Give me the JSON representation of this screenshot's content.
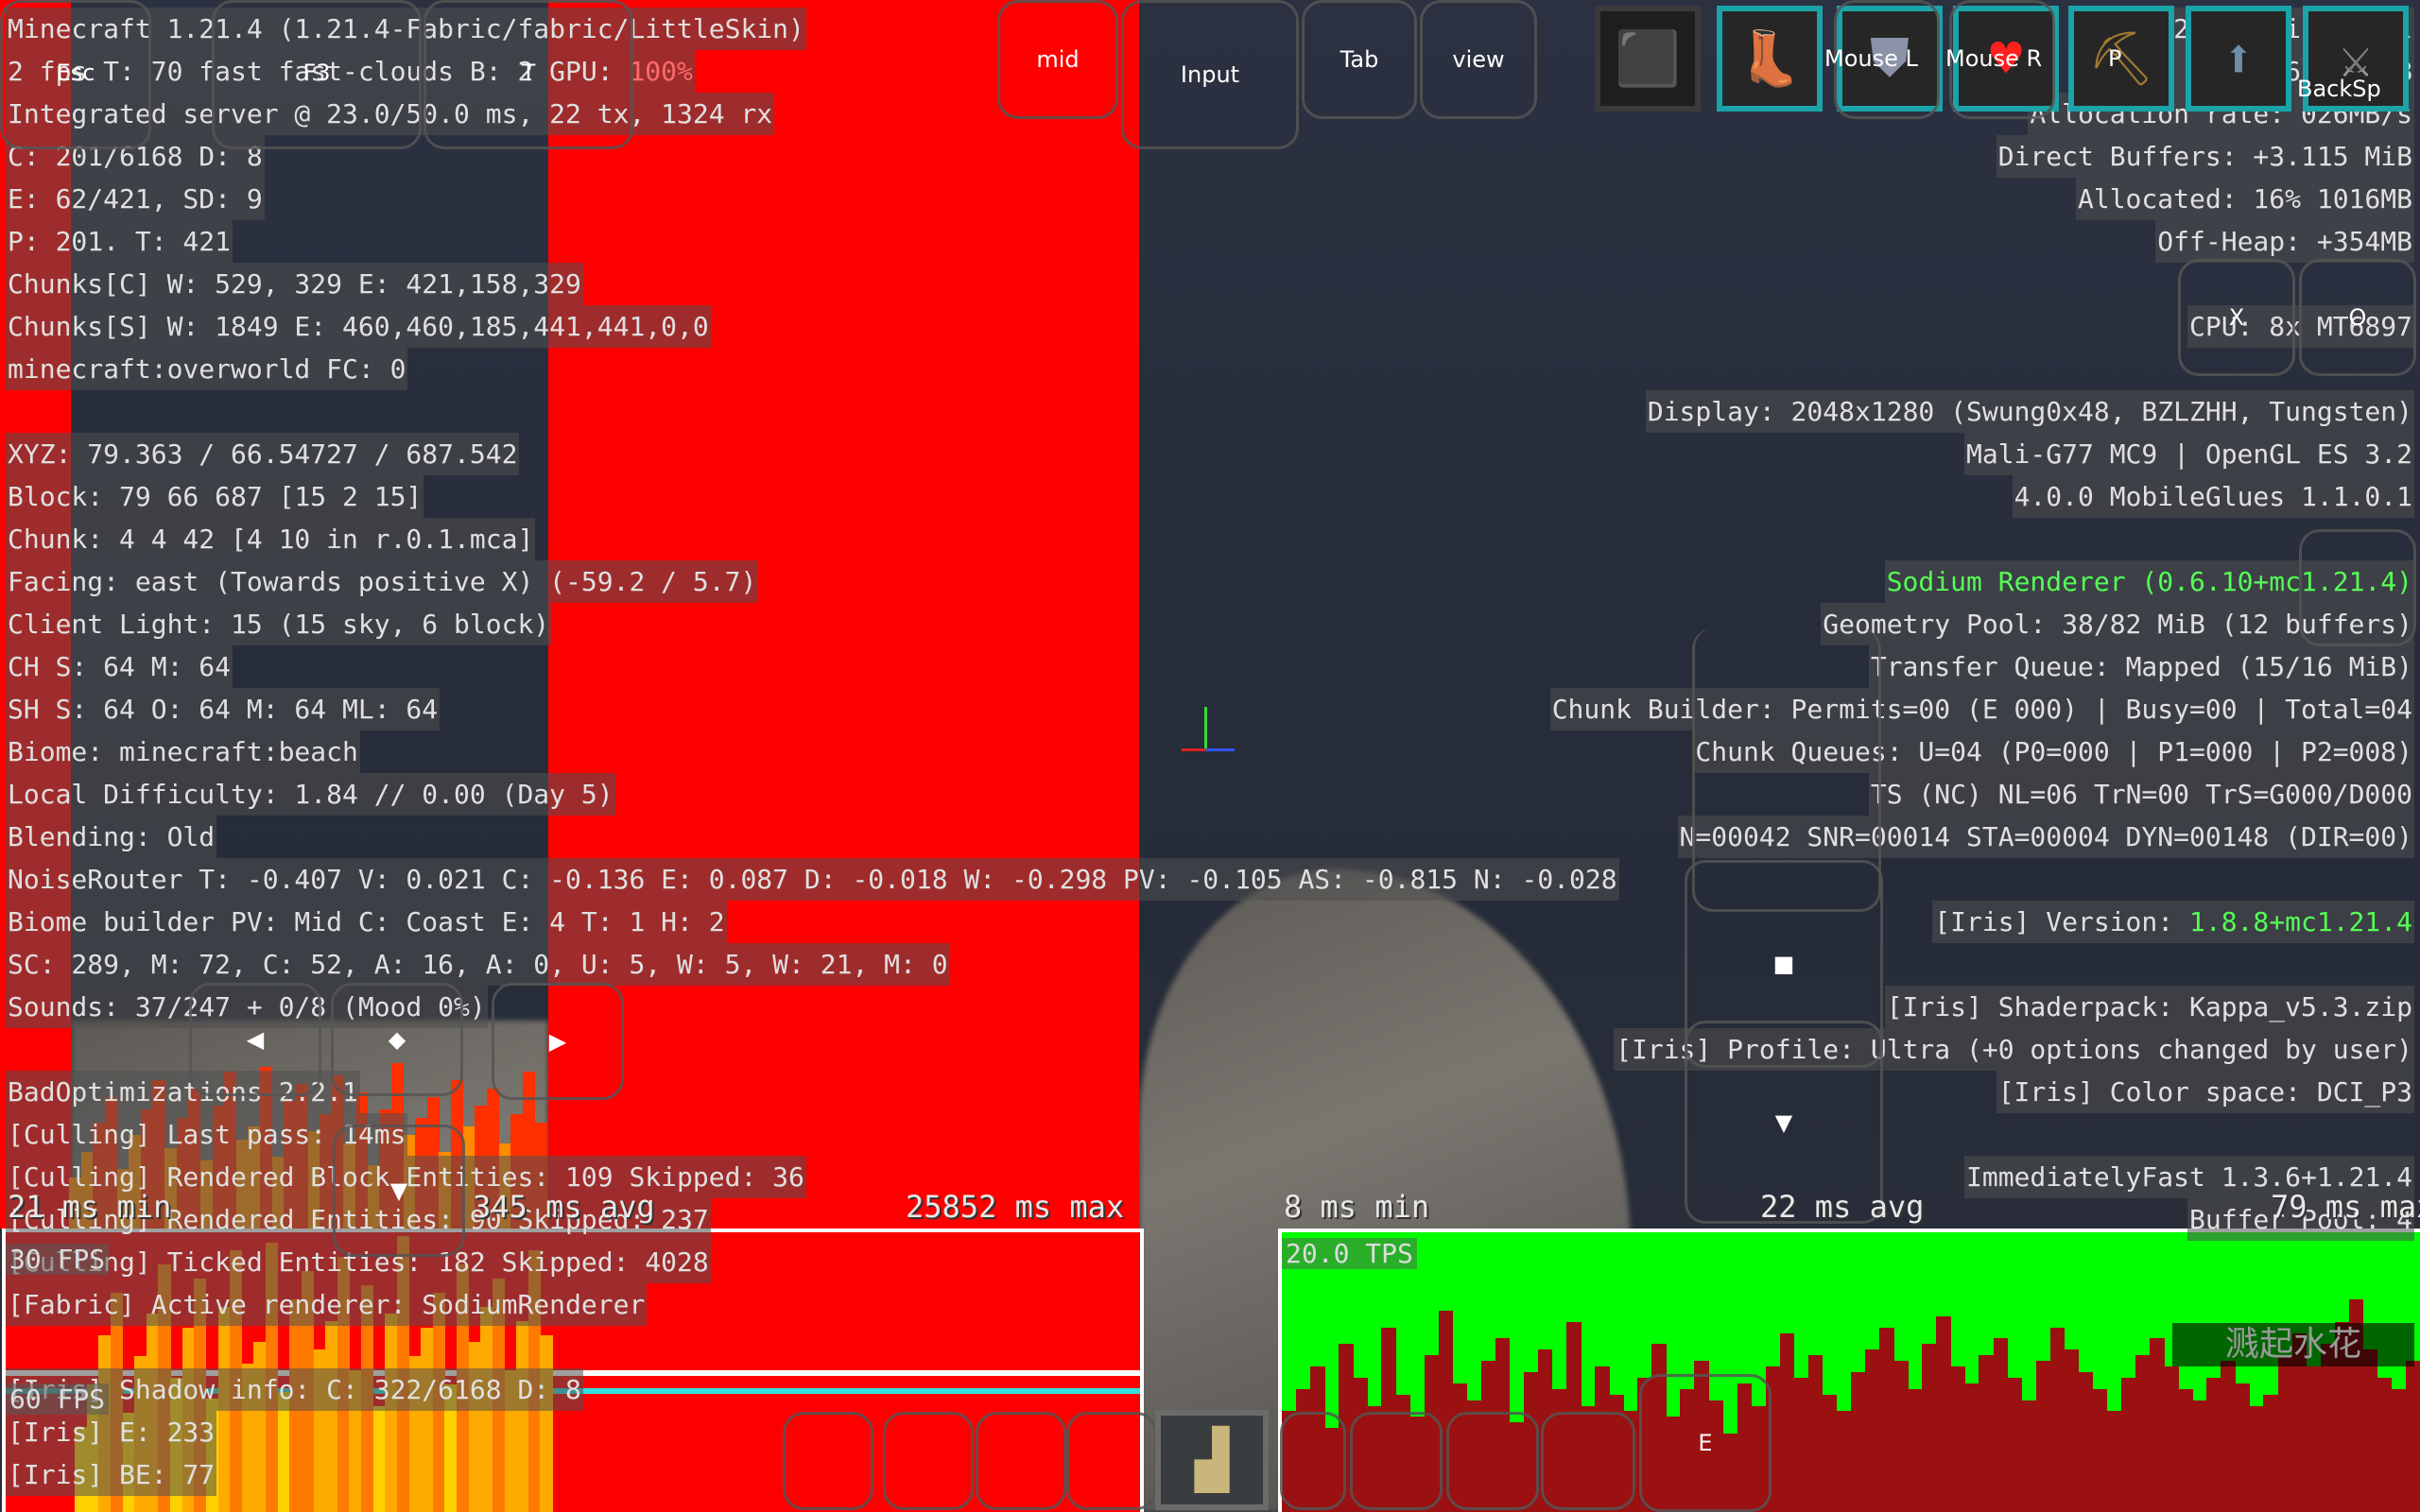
{
  "left_lines": [
    "Minecraft 1.21.4 (1.21.4-Fabric/fabric/LittleSkin)",
    {
      "parts": [
        "2 fps T: 70 fast fast-clouds B: 2 GPU: ",
        "100%"
      ]
    },
    "Integrated server @ 23.0/50.0 ms, 22 tx, 1324 rx",
    "C: 201/6168 D: 8",
    "E: 62/421, SD: 9",
    "P: 201. T: 421",
    "Chunks[C] W: 529, 329 E: 421,158,329",
    "Chunks[S] W: 1849 E: 460,460,185,441,441,0,0",
    "minecraft:overworld FC: 0",
    "",
    "XYZ: 79.363 / 66.54727 / 687.542",
    "Block: 79 66 687 [15 2 15]",
    "Chunk: 4 4 42 [4 10 in r.0.1.mca]",
    "Facing: east (Towards positive X) (-59.2 / 5.7)",
    "Client Light: 15 (15 sky, 6 block)",
    "CH S: 64 M: 64",
    "SH S: 64 O: 64 M: 64 ML: 64",
    "Biome: minecraft:beach",
    "Local Difficulty: 1.84 // 0.00 (Day 5)",
    "Blending: Old",
    "NoiseRouter T: -0.407 V: 0.021 C: -0.136 E: 0.087 D: -0.018 W: -0.298 PV: -0.105 AS: -0.815 N: -0.028",
    "Biome builder PV: Mid C: Coast E: 4 T: 1 H: 2",
    "SC: 289, M: 72, C: 52, A: 16, A: 0, U: 5, W: 5, W: 21, M: 0",
    "Sounds: 37/247 + 0/8 (Mood 0%)",
    "",
    "BadOptimizations 2.2.1",
    "[Culling] Last pass: 14ms",
    "[Culling] Rendered Block Entities: 109 Skipped: 36",
    "[Culling] Rendered Entities: 90 Skipped: 237",
    "[Culling] Ticked Entities: 182 Skipped: 4028",
    "[Fabric] Active renderer: SodiumRenderer",
    "",
    "[Iris] Shadow info: C: 322/6168 D: 8",
    "[Iris] E: 233",
    "[Iris] BE: 77"
  ],
  "right_lines": [
    "Java: 21.0.1-internal",
    "Mem: 11% 696/6000MB",
    "Allocation rate: 026MB/s",
    "Direct Buffers: +3.115 MiB",
    "Allocated: 16% 1016MB",
    "Off-Heap: +354MB",
    "",
    "CPU: 8x MT6897",
    "",
    "Display: 2048x1280 (Swung0x48, BZLZHH, Tungsten)",
    "Mali-G77 MC9 | OpenGL ES 3.2",
    "4.0.0 MobileGlues 1.1.0.1",
    "",
    {
      "parts": [
        "",
        "Sodium Renderer (0.6.10+mc1.21.4)"
      ],
      "color": "green"
    },
    "Geometry Pool: 38/82 MiB (12 buffers)",
    "Transfer Queue: Mapped (15/16 MiB)",
    "Chunk Builder: Permits=00 (E 000) | Busy=00 | Total=04",
    "Chunk Queues: U=04 (P0=000 | P1=000 | P2=008)",
    "TS (NC) NL=06 TrN=00 TrS=G000/D000",
    "N=00042 SNR=00014 STA=00004 DYN=00148 (DIR=00)",
    "",
    {
      "parts": [
        "[Iris] Version: ",
        "1.8.8+mc1.21.4"
      ],
      "color": "green"
    },
    "",
    "[Iris] Shaderpack: Kappa_v5.3.zip",
    "[Iris] Profile: Ultra (+0 options changed by user)",
    "[Iris] Color space: DCI_P3",
    "",
    "ImmediatelyFast 1.3.6+1.21.4",
    "Buffer Pool: 4"
  ],
  "colors": {
    "green": "#55ff55",
    "gpu": "#ff6b6b",
    "red": "#ff0000",
    "tps_bg": "#00ff00",
    "tps_bar": "#9b1010",
    "teal": "#1aa3a8"
  },
  "touch_buttons": {
    "mid": "mid",
    "input": "Input",
    "tab": "Tab",
    "view": "view",
    "esc": "Esc",
    "f3": "F3",
    "t": "T",
    "p": "P",
    "backsp": "BackSp",
    "x": "X",
    "o": "O",
    "e": "E",
    "mouse_l": "Mouse L",
    "mouse_r": "Mouse R"
  },
  "dpad": {
    "left": "◀",
    "center": "◆",
    "right": "▶",
    "down": "▼",
    "jump": "■",
    "sneak": "▼"
  },
  "subtitle": "溅起水花",
  "chart_data": [
    {
      "type": "bar",
      "title": "Frame time",
      "min_label": "21 ms min",
      "avg_label": "345 ms avg",
      "max_label": "25852 ms max",
      "fps_30_label": "30 FPS",
      "fps_60_label": "60 FPS",
      "values_ms": [
        12,
        18,
        25,
        31,
        14,
        22,
        28,
        35,
        19,
        26,
        33,
        16,
        29,
        37,
        21,
        24,
        38,
        17,
        30,
        34,
        23,
        27,
        36,
        20,
        32,
        15,
        28,
        39,
        22,
        26,
        31,
        18,
        35,
        24,
        29,
        33,
        20,
        27,
        37,
        25
      ]
    },
    {
      "type": "bar",
      "title": "Tick time",
      "min_label": "8 ms min",
      "avg_label": "22 ms avg",
      "max_label": "79 ms max",
      "tps_label": "20.0 TPS",
      "ylim_ms": [
        0,
        50
      ],
      "values_ms": [
        18,
        22,
        26,
        15,
        30,
        24,
        19,
        33,
        21,
        17,
        28,
        36,
        23,
        20,
        27,
        31,
        16,
        25,
        29,
        22,
        34,
        19,
        26,
        21,
        18,
        24,
        30,
        17,
        22,
        27,
        20,
        14,
        23,
        19,
        26,
        32,
        24,
        28,
        21,
        18,
        25,
        29,
        33,
        27,
        22,
        30,
        35,
        26,
        23,
        28,
        31,
        24,
        20,
        27,
        33,
        29,
        25,
        22,
        18,
        24,
        28,
        31,
        26,
        22,
        20,
        24,
        27,
        23,
        19,
        21,
        28,
        32,
        26,
        30,
        34,
        38,
        29,
        24,
        22,
        27
      ]
    }
  ]
}
